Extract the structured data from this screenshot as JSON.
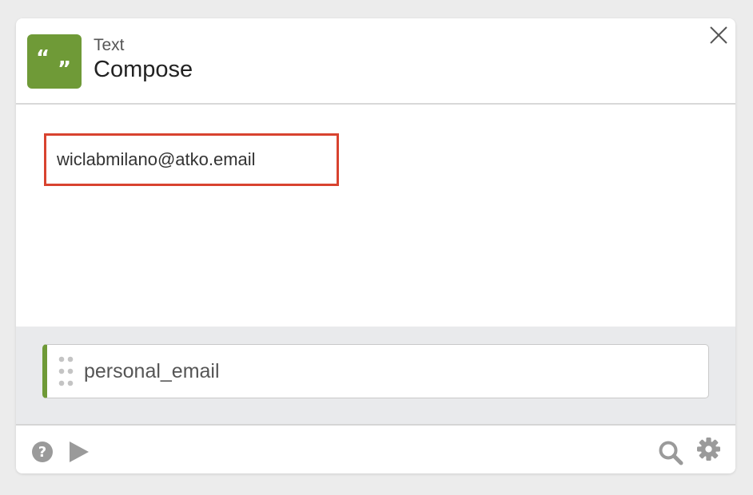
{
  "card": {
    "type_label": "Text",
    "title": "Compose",
    "icon": "quote-icon",
    "accent_color": "#6f9a37"
  },
  "composer": {
    "value": "wiclabmilano@atko.email",
    "highlight_color": "#d8432f"
  },
  "field_pill": {
    "label": "personal_email"
  },
  "footer": {
    "left_icons": [
      "help-icon",
      "play-icon"
    ],
    "right_icons": [
      "search-icon",
      "gear-icon"
    ]
  }
}
